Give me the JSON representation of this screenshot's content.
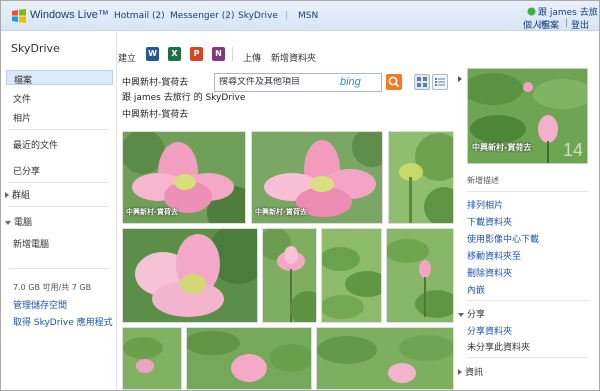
{
  "topbar": {
    "brand": "Windows Live™",
    "nav": [
      "Hotmail (2)",
      "Messenger (2)",
      "SkyDrive",
      "MSN"
    ],
    "user_name": "跟 james 去旅行",
    "user_links": [
      "個人檔案",
      "登出"
    ],
    "separator": "|"
  },
  "sidebar": {
    "title": "SkyDrive",
    "items": [
      "檔案",
      "文件",
      "相片",
      "最近的文件",
      "已分享",
      "群組",
      "電腦",
      "新增電腦"
    ],
    "storage": "7.0 GB 可用/共 7 GB",
    "links": [
      "管理儲存空間",
      "取得 SkyDrive 應用程式"
    ]
  },
  "toolbar": {
    "create_label": "建立",
    "office_icons": [
      {
        "name": "word-icon",
        "glyph": "W",
        "color": "#2b5797"
      },
      {
        "name": "excel-icon",
        "glyph": "X",
        "color": "#1e7145"
      },
      {
        "name": "powerpoint-icon",
        "glyph": "P",
        "color": "#d24726"
      },
      {
        "name": "onenote-icon",
        "glyph": "N",
        "color": "#80397b"
      }
    ],
    "upload_label": "上傳",
    "new_folder_label": "新增資料夾"
  },
  "header": {
    "breadcrumb_top": "中興新村-賞荷去",
    "folder_owner": "跟 james 去旅行 的 SkyDrive",
    "folder_name": "中興新村-賞荷去",
    "search_placeholder": "搜尋文件及其他項目",
    "bing_label": "bing"
  },
  "photos": {
    "watermark": "中興新村-賞荷去"
  },
  "rpanel": {
    "thumb_caption": "中興新村-賞荷去",
    "thumb_count": "14",
    "desc_label": "新增描述",
    "links": [
      "排列相片",
      "下載資料夾",
      "使用影像中心下載",
      "移動資料夾至",
      "刪除資料夾",
      "內嵌"
    ],
    "share_heading": "分享",
    "share_link": "分享資料夾",
    "share_status": "未分享此資料夾",
    "info_heading": "資訊"
  }
}
